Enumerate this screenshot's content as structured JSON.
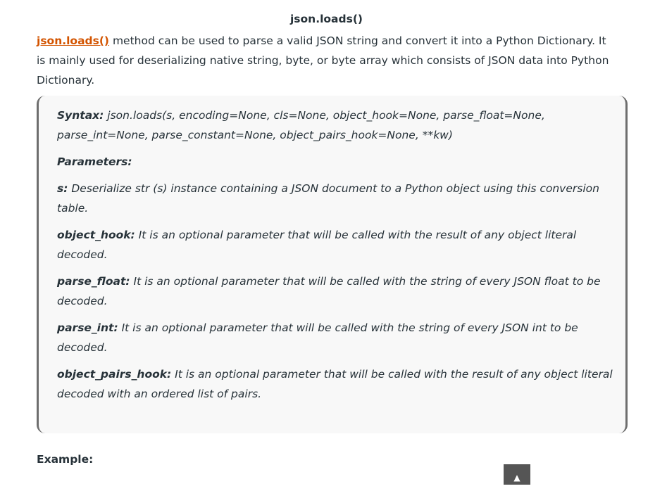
{
  "title": "json.loads()",
  "intro": {
    "link_text": "json.loads()",
    "text": " method can be used to parse a valid JSON string and convert it into a Python Dictionary. It is mainly used for deserializing native string, byte, or byte array which consists of JSON data into Python Dictionary."
  },
  "syntax": {
    "label": "Syntax:",
    "text": " json.loads(s, encoding=None, cls=None, object_hook=None, parse_float=None, parse_int=None, parse_constant=None, object_pairs_hook=None, **kw)"
  },
  "parameters_label": "Parameters:",
  "params": [
    {
      "name": "s:",
      "desc": " Deserialize str (s) instance containing a JSON document to a Python object using this conversion table."
    },
    {
      "name": "object_hook:",
      "desc": " It is an optional parameter that will be called with the result of any object literal decoded."
    },
    {
      "name": "parse_float:",
      "desc": " It is an optional parameter that will be called with the string of every JSON float to be decoded."
    },
    {
      "name": "parse_int:",
      "desc": " It is an optional parameter that will be called with the string of every JSON int to be decoded."
    },
    {
      "name": "object_pairs_hook:",
      "desc": " It is an optional parameter that will be called with the result of any object literal decoded with an ordered list of pairs."
    }
  ],
  "example_label": "Example:",
  "scroll_top_icon": "▲"
}
